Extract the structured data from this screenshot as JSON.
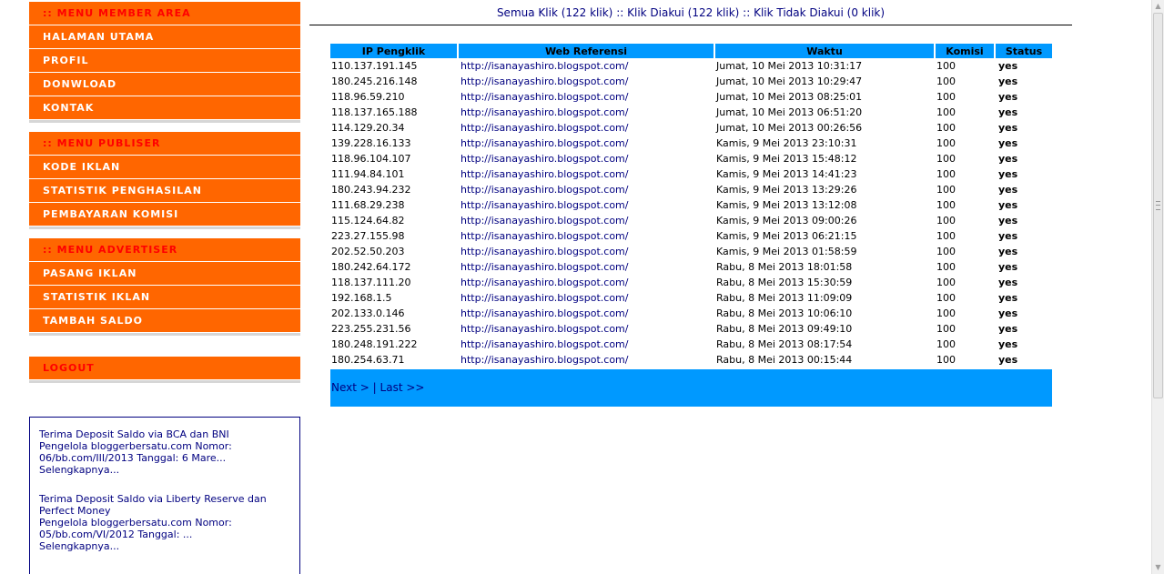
{
  "menu_member": {
    "header": ":: MENU MEMBER AREA",
    "items": [
      "HALAMAN UTAMA",
      "PROFIL",
      "DONWLOAD",
      "KONTAK"
    ]
  },
  "menu_publisher": {
    "header": ":: MENU PUBLISER",
    "items": [
      "KODE IKLAN",
      "STATISTIK PENGHASILAN",
      "PEMBAYARAN KOMISI"
    ]
  },
  "menu_advertiser": {
    "header": ":: MENU ADVERTISER",
    "items": [
      "PASANG IKLAN",
      "STATISTIK IKLAN",
      "TAMBAH SALDO"
    ]
  },
  "logout": "LOGOUT",
  "news": [
    {
      "title": "Terima Deposit Saldo via BCA dan BNI",
      "body": "Pengelola bloggerbersatu.com Nomor: 06/bb.com/III/2013 Tanggal: 6 Mare...",
      "more": "Selengkapnya..."
    },
    {
      "title": "Terima Deposit Saldo via Liberty Reserve dan Perfect Money",
      "body": "Pengelola bloggerbersatu.com Nomor: 05/bb.com/VI/2012 Tanggal: ...",
      "more": "Selengkapnya..."
    }
  ],
  "summary": {
    "all": "Semua Klik (122 klik)",
    "accepted": "Klik Diakui (122 klik)",
    "rejected": "Klik Tidak Diakui (0 klik)",
    "separator": "::"
  },
  "table": {
    "headers": [
      "IP Pengklik",
      "Web Referensi",
      "Waktu",
      "Komisi",
      "Status"
    ],
    "rows": [
      [
        "110.137.191.145",
        "http://isanayashiro.blogspot.com/",
        "Jumat, 10 Mei 2013 10:31:17",
        "100",
        "yes"
      ],
      [
        "180.245.216.148",
        "http://isanayashiro.blogspot.com/",
        "Jumat, 10 Mei 2013 10:29:47",
        "100",
        "yes"
      ],
      [
        "118.96.59.210",
        "http://isanayashiro.blogspot.com/",
        "Jumat, 10 Mei 2013 08:25:01",
        "100",
        "yes"
      ],
      [
        "118.137.165.188",
        "http://isanayashiro.blogspot.com/",
        "Jumat, 10 Mei 2013 06:51:20",
        "100",
        "yes"
      ],
      [
        "114.129.20.34",
        "http://isanayashiro.blogspot.com/",
        "Jumat, 10 Mei 2013 00:26:56",
        "100",
        "yes"
      ],
      [
        "139.228.16.133",
        "http://isanayashiro.blogspot.com/",
        "Kamis, 9 Mei 2013 23:10:31",
        "100",
        "yes"
      ],
      [
        "118.96.104.107",
        "http://isanayashiro.blogspot.com/",
        "Kamis, 9 Mei 2013 15:48:12",
        "100",
        "yes"
      ],
      [
        "111.94.84.101",
        "http://isanayashiro.blogspot.com/",
        "Kamis, 9 Mei 2013 14:41:23",
        "100",
        "yes"
      ],
      [
        "180.243.94.232",
        "http://isanayashiro.blogspot.com/",
        "Kamis, 9 Mei 2013 13:29:26",
        "100",
        "yes"
      ],
      [
        "111.68.29.238",
        "http://isanayashiro.blogspot.com/",
        "Kamis, 9 Mei 2013 13:12:08",
        "100",
        "yes"
      ],
      [
        "115.124.64.82",
        "http://isanayashiro.blogspot.com/",
        "Kamis, 9 Mei 2013 09:00:26",
        "100",
        "yes"
      ],
      [
        "223.27.155.98",
        "http://isanayashiro.blogspot.com/",
        "Kamis, 9 Mei 2013 06:21:15",
        "100",
        "yes"
      ],
      [
        "202.52.50.203",
        "http://isanayashiro.blogspot.com/",
        "Kamis, 9 Mei 2013 01:58:59",
        "100",
        "yes"
      ],
      [
        "180.242.64.172",
        "http://isanayashiro.blogspot.com/",
        "Rabu, 8 Mei 2013 18:01:58",
        "100",
        "yes"
      ],
      [
        "118.137.111.20",
        "http://isanayashiro.blogspot.com/",
        "Rabu, 8 Mei 2013 15:30:59",
        "100",
        "yes"
      ],
      [
        "192.168.1.5",
        "http://isanayashiro.blogspot.com/",
        "Rabu, 8 Mei 2013 11:09:09",
        "100",
        "yes"
      ],
      [
        "202.133.0.146",
        "http://isanayashiro.blogspot.com/",
        "Rabu, 8 Mei 2013 10:06:10",
        "100",
        "yes"
      ],
      [
        "223.255.231.56",
        "http://isanayashiro.blogspot.com/",
        "Rabu, 8 Mei 2013 09:49:10",
        "100",
        "yes"
      ],
      [
        "180.248.191.222",
        "http://isanayashiro.blogspot.com/",
        "Rabu, 8 Mei 2013 08:17:54",
        "100",
        "yes"
      ],
      [
        "180.254.63.71",
        "http://isanayashiro.blogspot.com/",
        "Rabu, 8 Mei 2013 00:15:44",
        "100",
        "yes"
      ]
    ]
  },
  "pager": {
    "next": "Next >",
    "separator": "|",
    "last": "Last >>"
  },
  "colors": {
    "menu_bg": "#ff6600",
    "menu_header_text": "#ff0000",
    "table_header_bg": "#0099ff",
    "link": "#000080"
  }
}
